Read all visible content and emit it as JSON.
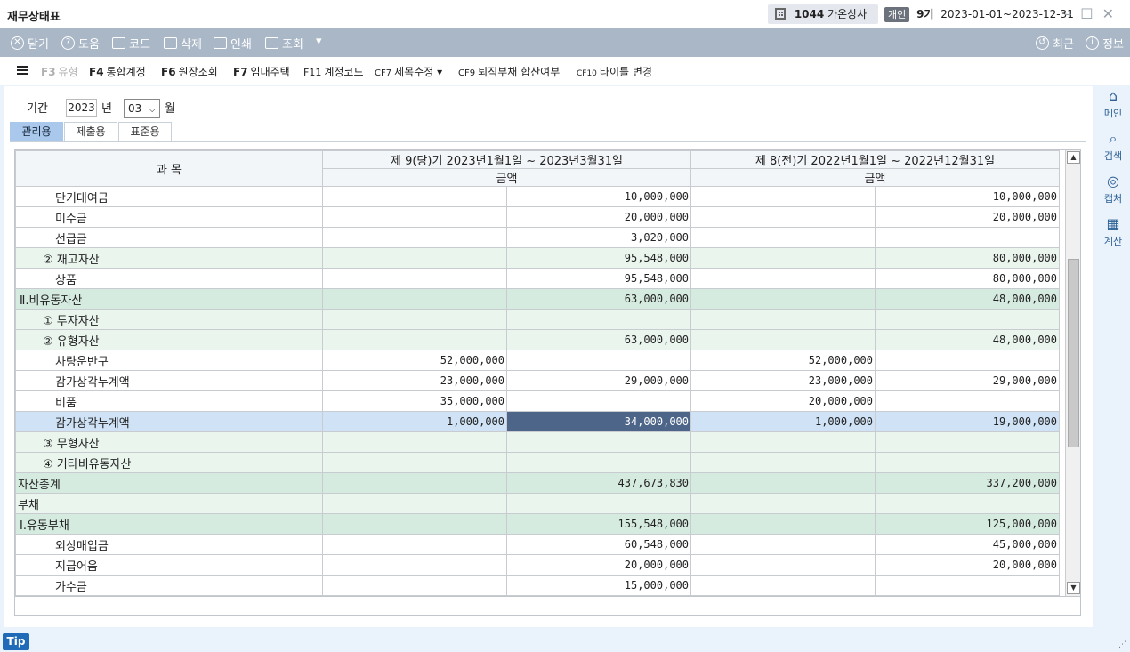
{
  "window": {
    "title": "재무상태표",
    "company_code": "1044",
    "company_name": "가온상사",
    "type_badge": "개인",
    "term": "9기",
    "period": "2023-01-01~2023-12-31"
  },
  "toolbar": {
    "close": "닫기",
    "help": "도움",
    "code": "코드",
    "delete": "삭제",
    "print": "인쇄",
    "search": "조회",
    "recent": "최근",
    "info": "정보"
  },
  "fkeys": [
    {
      "key": "F3",
      "label": "유형",
      "enabled": false
    },
    {
      "key": "F4",
      "label": "통합계정",
      "enabled": true
    },
    {
      "key": "F6",
      "label": "원장조회",
      "enabled": true
    },
    {
      "key": "F7",
      "label": "임대주택",
      "enabled": true
    },
    {
      "key": "F11",
      "label": "계정코드",
      "enabled": true
    },
    {
      "key": "CF7",
      "label": "제목수정",
      "enabled": true
    },
    {
      "key": "CF9",
      "label": "퇴직부채 합산여부",
      "enabled": true
    },
    {
      "key": "CF10",
      "label": "타이틀 변경",
      "enabled": true
    }
  ],
  "filter": {
    "period_label": "기간",
    "year": "2023",
    "year_unit": "년",
    "month": "03",
    "month_unit": "월"
  },
  "tabs": [
    "관리용",
    "제출용",
    "표준용"
  ],
  "table": {
    "col_subject": "과 목",
    "col_current": "제 9(당)기 2023년1월1일 ~ 2023년3월31일",
    "col_prior": "제 8(전)기 2022년1월1일 ~ 2022년12월31일",
    "amount": "금액",
    "rows": [
      {
        "name": "단기대여금",
        "c1": "",
        "c2": "10,000,000",
        "p1": "",
        "p2": "10,000,000"
      },
      {
        "name": "미수금",
        "c1": "",
        "c2": "20,000,000",
        "p1": "",
        "p2": "20,000,000"
      },
      {
        "name": "선급금",
        "c1": "",
        "c2": "3,020,000",
        "p1": "",
        "p2": ""
      },
      {
        "name": "② 재고자산",
        "c1": "",
        "c2": "95,548,000",
        "p1": "",
        "p2": "80,000,000"
      },
      {
        "name": "상품",
        "c1": "",
        "c2": "95,548,000",
        "p1": "",
        "p2": "80,000,000"
      },
      {
        "name": "Ⅱ.비유동자산",
        "c1": "",
        "c2": "63,000,000",
        "p1": "",
        "p2": "48,000,000"
      },
      {
        "name": "① 투자자산",
        "c1": "",
        "c2": "",
        "p1": "",
        "p2": ""
      },
      {
        "name": "② 유형자산",
        "c1": "",
        "c2": "63,000,000",
        "p1": "",
        "p2": "48,000,000"
      },
      {
        "name": "차량운반구",
        "c1": "52,000,000",
        "c2": "",
        "p1": "52,000,000",
        "p2": ""
      },
      {
        "name": "감가상각누계액",
        "c1": "23,000,000",
        "c2": "29,000,000",
        "p1": "23,000,000",
        "p2": "29,000,000"
      },
      {
        "name": "비품",
        "c1": "35,000,000",
        "c2": "",
        "p1": "20,000,000",
        "p2": ""
      },
      {
        "name": "감가상각누계액",
        "c1": "1,000,000",
        "c2": "34,000,000",
        "p1": "1,000,000",
        "p2": "19,000,000"
      },
      {
        "name": "③ 무형자산",
        "c1": "",
        "c2": "",
        "p1": "",
        "p2": ""
      },
      {
        "name": "④ 기타비유동자산",
        "c1": "",
        "c2": "",
        "p1": "",
        "p2": ""
      },
      {
        "name": "자산총계",
        "c1": "",
        "c2": "437,673,830",
        "p1": "",
        "p2": "337,200,000"
      },
      {
        "name": "부채",
        "c1": "",
        "c2": "",
        "p1": "",
        "p2": ""
      },
      {
        "name": "Ⅰ.유동부채",
        "c1": "",
        "c2": "155,548,000",
        "p1": "",
        "p2": "125,000,000"
      },
      {
        "name": "외상매입금",
        "c1": "",
        "c2": "60,548,000",
        "p1": "",
        "p2": "45,000,000"
      },
      {
        "name": "지급어음",
        "c1": "",
        "c2": "20,000,000",
        "p1": "",
        "p2": "20,000,000"
      },
      {
        "name": "가수금",
        "c1": "",
        "c2": "15,000,000",
        "p1": "",
        "p2": ""
      }
    ]
  },
  "side": {
    "main": "메인",
    "search": "검색",
    "capture": "캡처",
    "calc": "계산"
  },
  "tip": "Tip"
}
